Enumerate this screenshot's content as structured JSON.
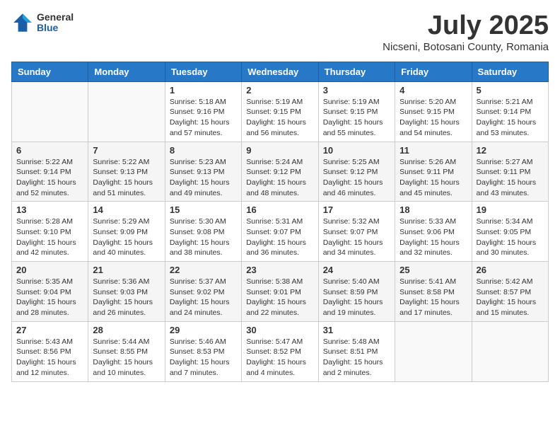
{
  "logo": {
    "general": "General",
    "blue": "Blue"
  },
  "title": "July 2025",
  "subtitle": "Nicseni, Botosani County, Romania",
  "days_of_week": [
    "Sunday",
    "Monday",
    "Tuesday",
    "Wednesday",
    "Thursday",
    "Friday",
    "Saturday"
  ],
  "weeks": [
    [
      {
        "day": "",
        "sunrise": "",
        "sunset": "",
        "daylight": ""
      },
      {
        "day": "",
        "sunrise": "",
        "sunset": "",
        "daylight": ""
      },
      {
        "day": "1",
        "sunrise": "Sunrise: 5:18 AM",
        "sunset": "Sunset: 9:16 PM",
        "daylight": "Daylight: 15 hours and 57 minutes."
      },
      {
        "day": "2",
        "sunrise": "Sunrise: 5:19 AM",
        "sunset": "Sunset: 9:15 PM",
        "daylight": "Daylight: 15 hours and 56 minutes."
      },
      {
        "day": "3",
        "sunrise": "Sunrise: 5:19 AM",
        "sunset": "Sunset: 9:15 PM",
        "daylight": "Daylight: 15 hours and 55 minutes."
      },
      {
        "day": "4",
        "sunrise": "Sunrise: 5:20 AM",
        "sunset": "Sunset: 9:15 PM",
        "daylight": "Daylight: 15 hours and 54 minutes."
      },
      {
        "day": "5",
        "sunrise": "Sunrise: 5:21 AM",
        "sunset": "Sunset: 9:14 PM",
        "daylight": "Daylight: 15 hours and 53 minutes."
      }
    ],
    [
      {
        "day": "6",
        "sunrise": "Sunrise: 5:22 AM",
        "sunset": "Sunset: 9:14 PM",
        "daylight": "Daylight: 15 hours and 52 minutes."
      },
      {
        "day": "7",
        "sunrise": "Sunrise: 5:22 AM",
        "sunset": "Sunset: 9:13 PM",
        "daylight": "Daylight: 15 hours and 51 minutes."
      },
      {
        "day": "8",
        "sunrise": "Sunrise: 5:23 AM",
        "sunset": "Sunset: 9:13 PM",
        "daylight": "Daylight: 15 hours and 49 minutes."
      },
      {
        "day": "9",
        "sunrise": "Sunrise: 5:24 AM",
        "sunset": "Sunset: 9:12 PM",
        "daylight": "Daylight: 15 hours and 48 minutes."
      },
      {
        "day": "10",
        "sunrise": "Sunrise: 5:25 AM",
        "sunset": "Sunset: 9:12 PM",
        "daylight": "Daylight: 15 hours and 46 minutes."
      },
      {
        "day": "11",
        "sunrise": "Sunrise: 5:26 AM",
        "sunset": "Sunset: 9:11 PM",
        "daylight": "Daylight: 15 hours and 45 minutes."
      },
      {
        "day": "12",
        "sunrise": "Sunrise: 5:27 AM",
        "sunset": "Sunset: 9:11 PM",
        "daylight": "Daylight: 15 hours and 43 minutes."
      }
    ],
    [
      {
        "day": "13",
        "sunrise": "Sunrise: 5:28 AM",
        "sunset": "Sunset: 9:10 PM",
        "daylight": "Daylight: 15 hours and 42 minutes."
      },
      {
        "day": "14",
        "sunrise": "Sunrise: 5:29 AM",
        "sunset": "Sunset: 9:09 PM",
        "daylight": "Daylight: 15 hours and 40 minutes."
      },
      {
        "day": "15",
        "sunrise": "Sunrise: 5:30 AM",
        "sunset": "Sunset: 9:08 PM",
        "daylight": "Daylight: 15 hours and 38 minutes."
      },
      {
        "day": "16",
        "sunrise": "Sunrise: 5:31 AM",
        "sunset": "Sunset: 9:07 PM",
        "daylight": "Daylight: 15 hours and 36 minutes."
      },
      {
        "day": "17",
        "sunrise": "Sunrise: 5:32 AM",
        "sunset": "Sunset: 9:07 PM",
        "daylight": "Daylight: 15 hours and 34 minutes."
      },
      {
        "day": "18",
        "sunrise": "Sunrise: 5:33 AM",
        "sunset": "Sunset: 9:06 PM",
        "daylight": "Daylight: 15 hours and 32 minutes."
      },
      {
        "day": "19",
        "sunrise": "Sunrise: 5:34 AM",
        "sunset": "Sunset: 9:05 PM",
        "daylight": "Daylight: 15 hours and 30 minutes."
      }
    ],
    [
      {
        "day": "20",
        "sunrise": "Sunrise: 5:35 AM",
        "sunset": "Sunset: 9:04 PM",
        "daylight": "Daylight: 15 hours and 28 minutes."
      },
      {
        "day": "21",
        "sunrise": "Sunrise: 5:36 AM",
        "sunset": "Sunset: 9:03 PM",
        "daylight": "Daylight: 15 hours and 26 minutes."
      },
      {
        "day": "22",
        "sunrise": "Sunrise: 5:37 AM",
        "sunset": "Sunset: 9:02 PM",
        "daylight": "Daylight: 15 hours and 24 minutes."
      },
      {
        "day": "23",
        "sunrise": "Sunrise: 5:38 AM",
        "sunset": "Sunset: 9:01 PM",
        "daylight": "Daylight: 15 hours and 22 minutes."
      },
      {
        "day": "24",
        "sunrise": "Sunrise: 5:40 AM",
        "sunset": "Sunset: 8:59 PM",
        "daylight": "Daylight: 15 hours and 19 minutes."
      },
      {
        "day": "25",
        "sunrise": "Sunrise: 5:41 AM",
        "sunset": "Sunset: 8:58 PM",
        "daylight": "Daylight: 15 hours and 17 minutes."
      },
      {
        "day": "26",
        "sunrise": "Sunrise: 5:42 AM",
        "sunset": "Sunset: 8:57 PM",
        "daylight": "Daylight: 15 hours and 15 minutes."
      }
    ],
    [
      {
        "day": "27",
        "sunrise": "Sunrise: 5:43 AM",
        "sunset": "Sunset: 8:56 PM",
        "daylight": "Daylight: 15 hours and 12 minutes."
      },
      {
        "day": "28",
        "sunrise": "Sunrise: 5:44 AM",
        "sunset": "Sunset: 8:55 PM",
        "daylight": "Daylight: 15 hours and 10 minutes."
      },
      {
        "day": "29",
        "sunrise": "Sunrise: 5:46 AM",
        "sunset": "Sunset: 8:53 PM",
        "daylight": "Daylight: 15 hours and 7 minutes."
      },
      {
        "day": "30",
        "sunrise": "Sunrise: 5:47 AM",
        "sunset": "Sunset: 8:52 PM",
        "daylight": "Daylight: 15 hours and 4 minutes."
      },
      {
        "day": "31",
        "sunrise": "Sunrise: 5:48 AM",
        "sunset": "Sunset: 8:51 PM",
        "daylight": "Daylight: 15 hours and 2 minutes."
      },
      {
        "day": "",
        "sunrise": "",
        "sunset": "",
        "daylight": ""
      },
      {
        "day": "",
        "sunrise": "",
        "sunset": "",
        "daylight": ""
      }
    ]
  ]
}
